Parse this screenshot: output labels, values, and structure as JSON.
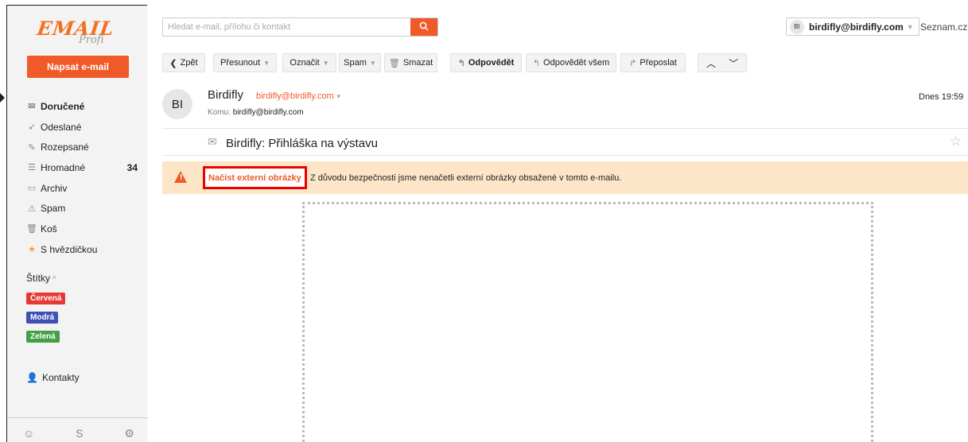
{
  "brand": {
    "logo_main": "EMAIL",
    "logo_sub": "Profi"
  },
  "sidebar": {
    "compose_label": "Napsat e-mail",
    "folders": [
      {
        "label": "Doručené",
        "icon": "inbox-icon",
        "count": ""
      },
      {
        "label": "Odeslané",
        "icon": "sent-icon",
        "count": ""
      },
      {
        "label": "Rozepsané",
        "icon": "drafts-icon",
        "count": ""
      },
      {
        "label": "Hromadné",
        "icon": "bulk-icon",
        "count": "34"
      },
      {
        "label": "Archiv",
        "icon": "archive-icon",
        "count": ""
      },
      {
        "label": "Spam",
        "icon": "spam-icon",
        "count": ""
      },
      {
        "label": "Koš",
        "icon": "trash-icon",
        "count": ""
      },
      {
        "label": "S hvězdičkou",
        "icon": "star-icon",
        "count": ""
      }
    ],
    "labels_heading": "Štítky",
    "tags": [
      {
        "label": "Červená",
        "color": "#e53935"
      },
      {
        "label": "Modrá",
        "color": "#3f51b5"
      },
      {
        "label": "Zelená",
        "color": "#43a047"
      }
    ],
    "contacts_label": "Kontakty",
    "bottom_icons": [
      "emoji-icon",
      "s-logo-icon",
      "settings-icon"
    ]
  },
  "header": {
    "search_placeholder": "Hledat e-mail, přílohu či kontakt",
    "account_initials": "BI",
    "account_email": "birdifly@birdifly.com",
    "portal_link": "Seznam.cz"
  },
  "toolbar": {
    "back": "Zpět",
    "move": "Přesunout",
    "mark": "Označit",
    "spam": "Spam",
    "delete": "Smazat",
    "reply": "Odpovědět",
    "reply_all": "Odpovědět všem",
    "forward": "Přeposlat"
  },
  "message": {
    "avatar_initials": "BI",
    "sender_name": "Birdifly",
    "sender_email": "birdifly@birdifly.com",
    "to_label": "Komu:",
    "to_value": "birdifly@birdifly.com",
    "time": "Dnes 19:59",
    "subject": "Birdifly: Přihláška na výstavu"
  },
  "warning": {
    "load_images_label": "Načíst externí obrázky",
    "text": "Z důvodu bezpečnosti jsme nenačetli externí obrázky obsažené v tomto e-mailu."
  },
  "colors": {
    "accent": "#f05a28",
    "warning_bg": "#fde6c7",
    "highlight_border": "#ee0000"
  }
}
